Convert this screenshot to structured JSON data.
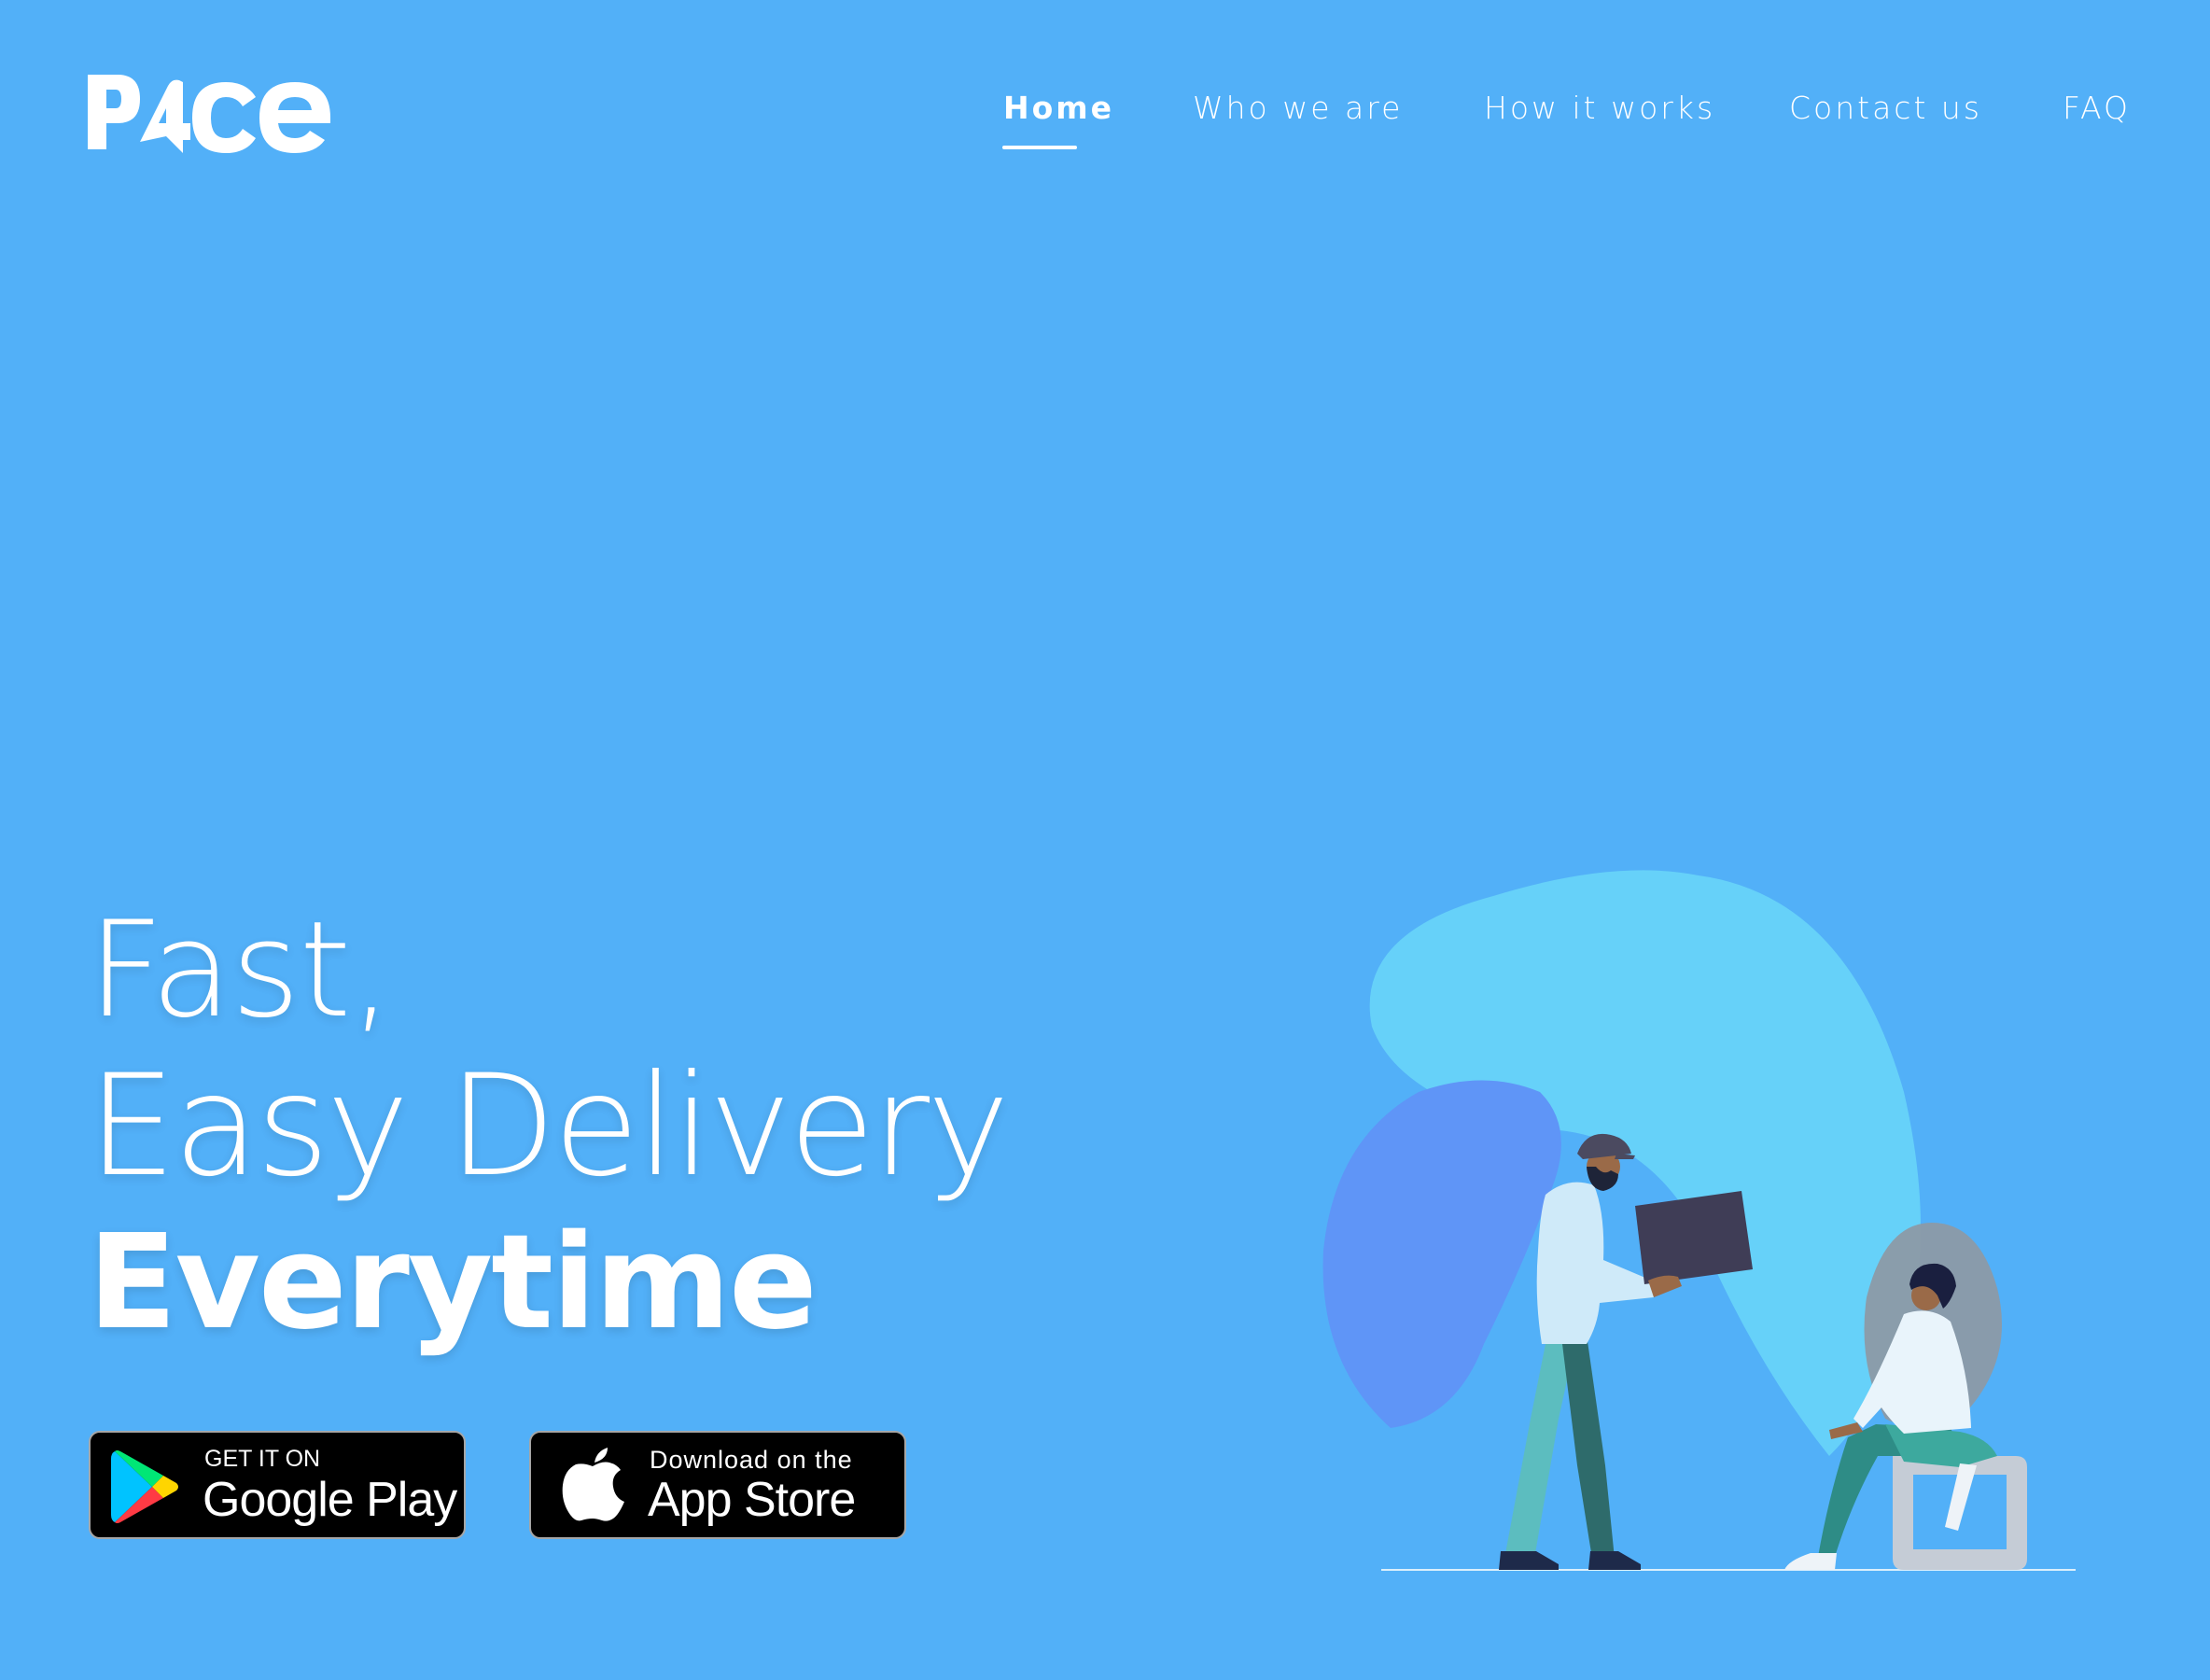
{
  "brand": {
    "logo_text": "P4ce"
  },
  "nav": {
    "items": [
      {
        "label": "Home",
        "active": true
      },
      {
        "label": "Who we are"
      },
      {
        "label": "How it works"
      },
      {
        "label": "Contact us"
      },
      {
        "label": "FAQ"
      }
    ]
  },
  "hero": {
    "line1": "Fast,",
    "line2": "Easy Delivery",
    "line3": "Everytime"
  },
  "stores": {
    "google": {
      "small": "GET IT ON",
      "big": "Google Play"
    },
    "apple": {
      "small": "Download on the",
      "big": "App Store"
    }
  },
  "colors": {
    "background": "#52b0f8",
    "text": "#ffffff"
  }
}
